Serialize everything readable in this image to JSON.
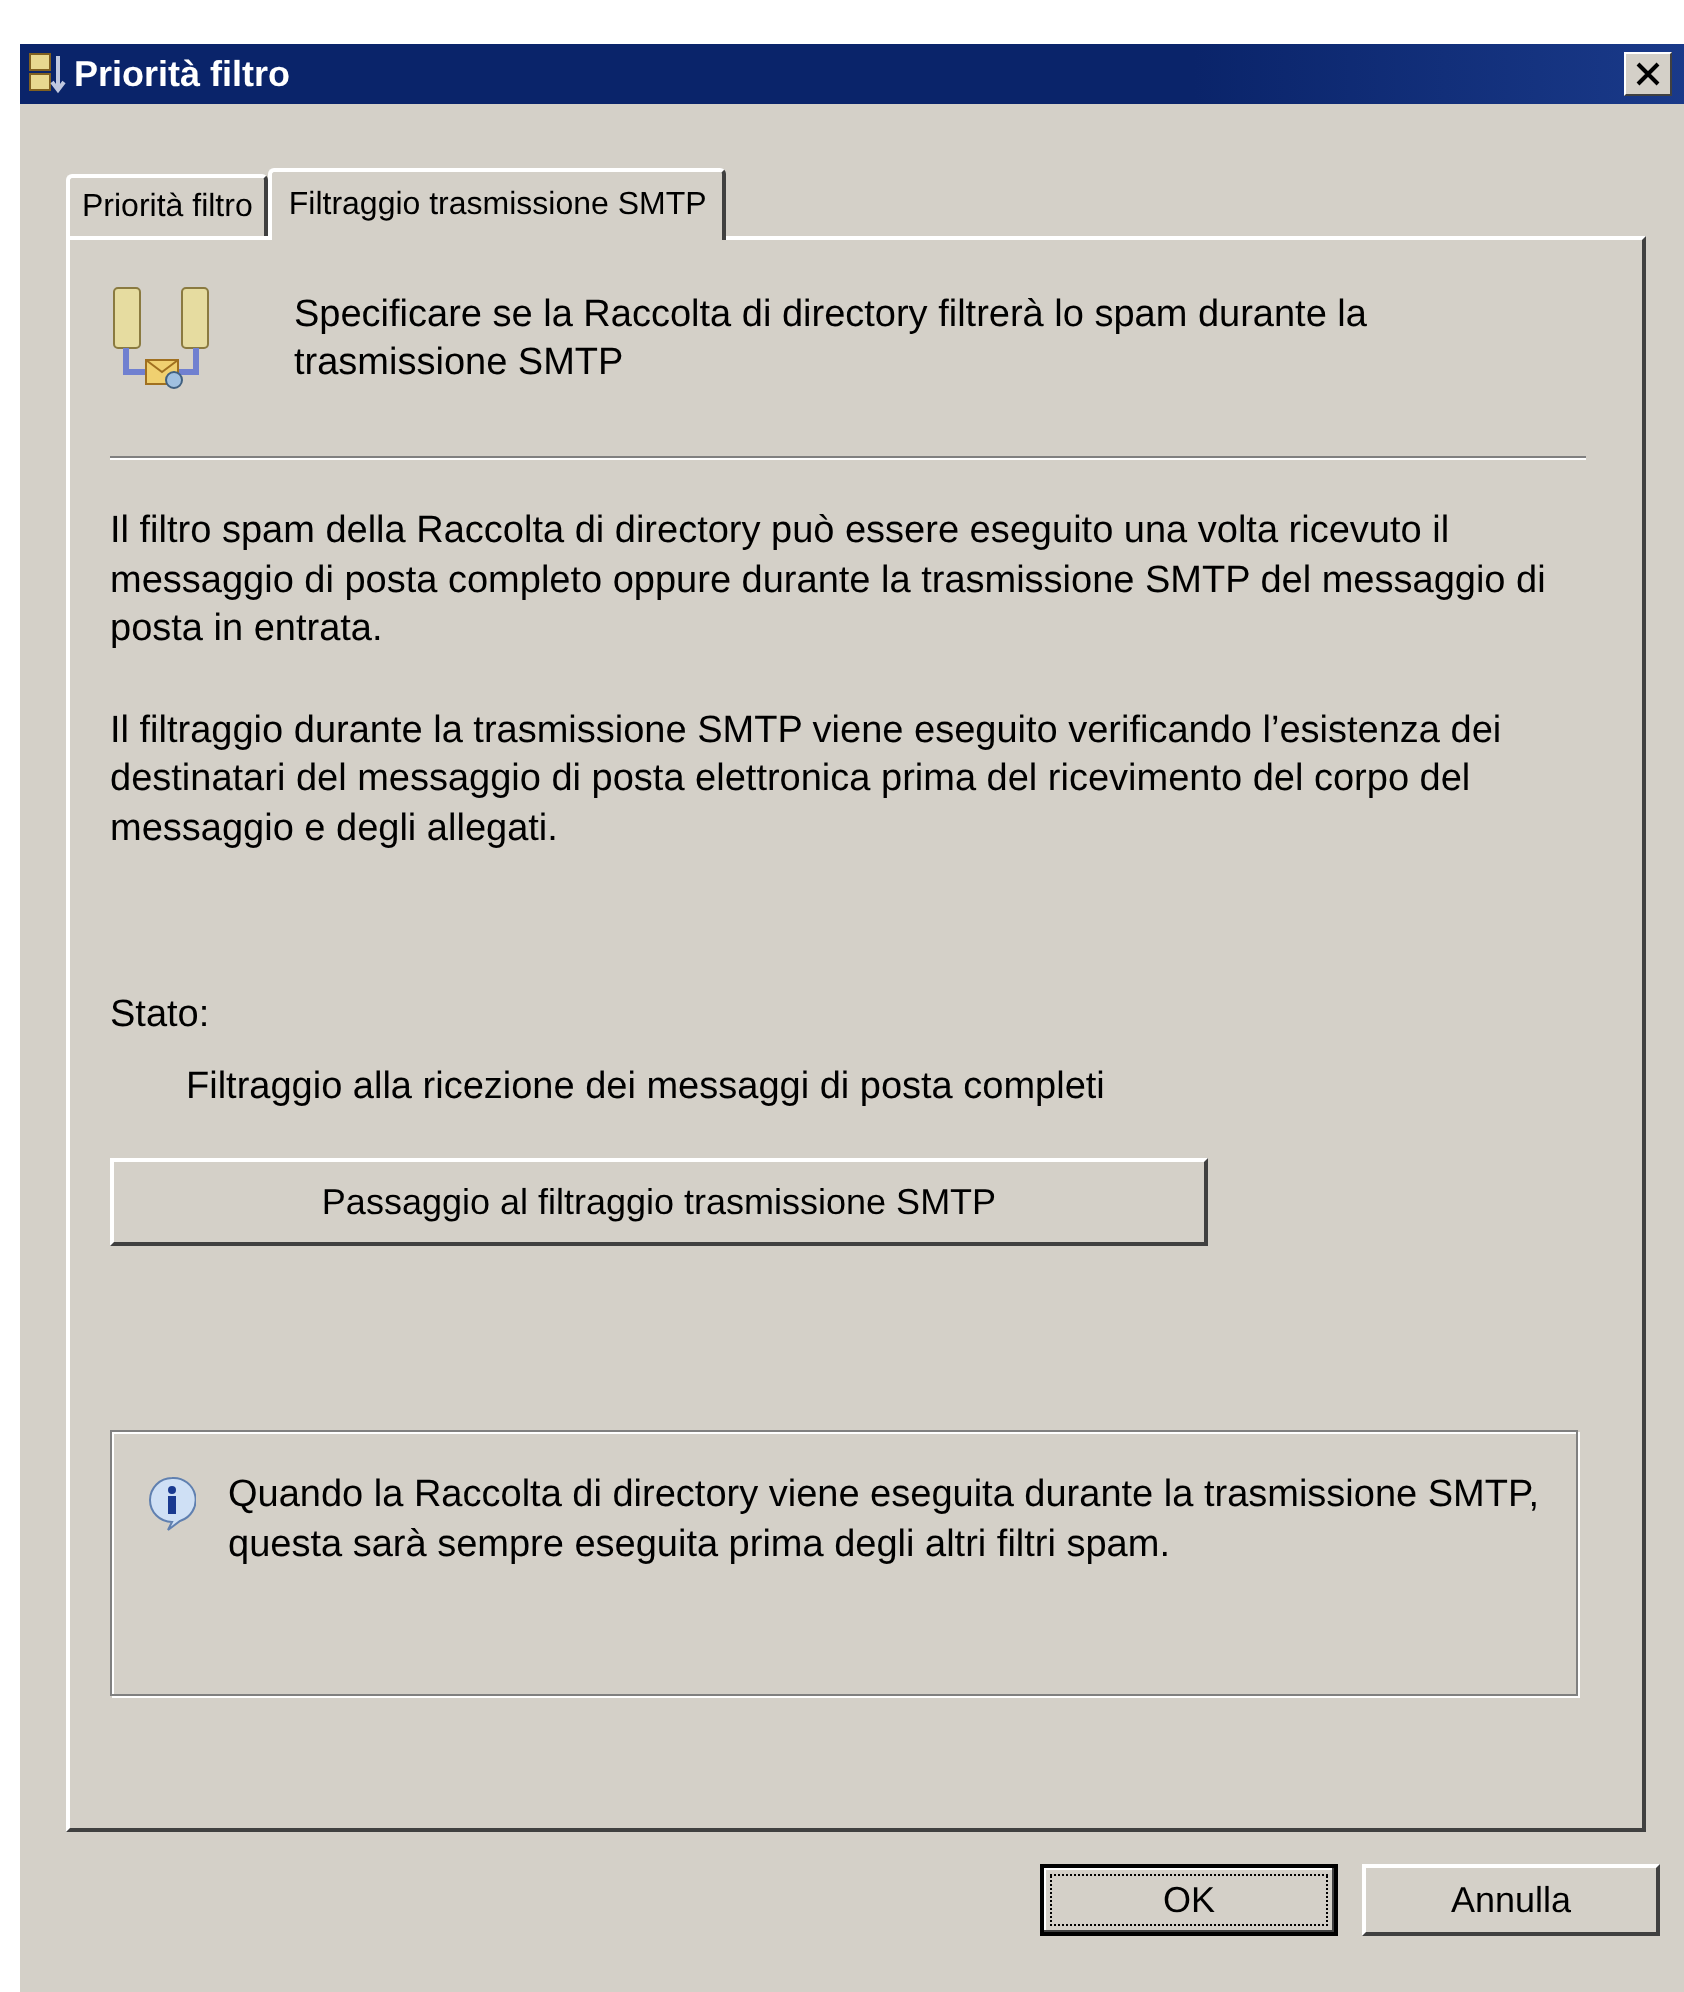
{
  "window": {
    "title": "Priorità filtro"
  },
  "tabs": [
    {
      "label": "Priorità filtro",
      "selected": false
    },
    {
      "label": "Filtraggio trasmissione SMTP",
      "selected": true
    }
  ],
  "header": "Specificare se la Raccolta di directory filtrerà lo spam durante la trasmissione SMTP",
  "paragraphs": [
    "Il filtro spam della Raccolta di directory può essere eseguito una volta ricevuto il messaggio di posta completo oppure durante la trasmissione SMTP del messaggio di posta in entrata.",
    "Il filtraggio durante la trasmissione SMTP viene eseguito verificando l’esistenza dei destinatari del messaggio di posta elettronica prima del ricevimento del corpo del messaggio e degli allegati."
  ],
  "status": {
    "label": "Stato:",
    "value": "Filtraggio alla ricezione dei messaggi di posta completi"
  },
  "action_button": "Passaggio al filtraggio trasmissione SMTP",
  "info": "Quando la Raccolta di directory viene eseguita durante la trasmissione SMTP, questa sarà sempre eseguita prima degli altri filtri spam.",
  "buttons": [
    {
      "label": "OK",
      "default": true
    },
    {
      "label": "Annulla",
      "default": false
    }
  ]
}
